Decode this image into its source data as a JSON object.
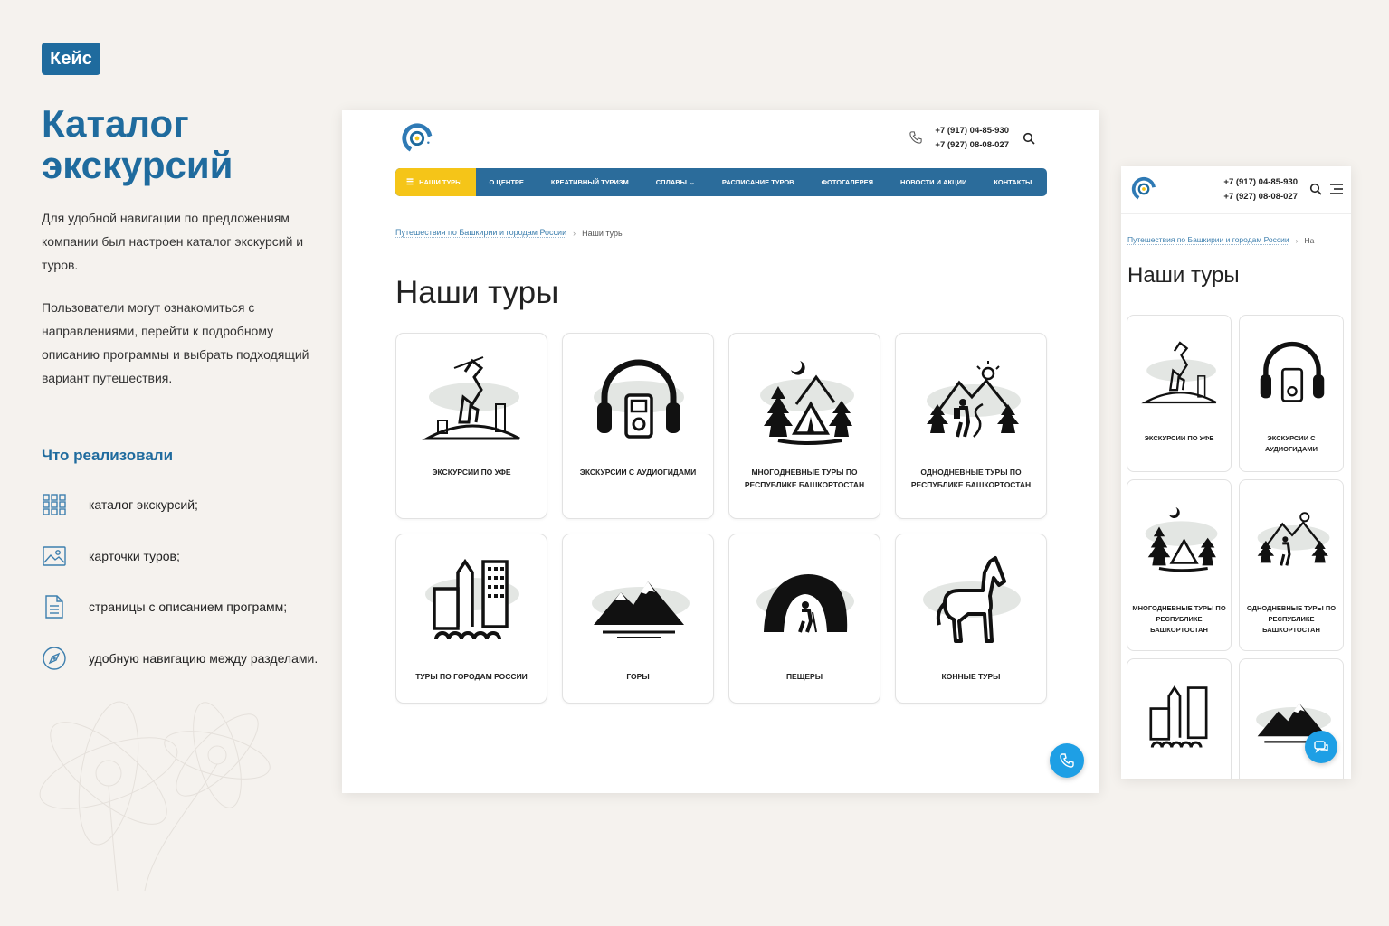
{
  "case": {
    "badge": "Кейс",
    "title": "Каталог экскурсий",
    "paragraph1": "Для удобной навигации по предложениям компании был настроен каталог экскурсий и туров.",
    "paragraph2": "Пользователи могут ознакомиться с направлениями, перейти к подробному описанию программы и выбрать подходящий вариант путешествия.",
    "done_title": "Что реализовали",
    "features": [
      {
        "icon": "grid-icon",
        "label": "каталог экскурсий;"
      },
      {
        "icon": "image-icon",
        "label": "карточки туров;"
      },
      {
        "icon": "document-icon",
        "label": "страницы с описанием программ;"
      },
      {
        "icon": "compass-icon",
        "label": "удобную навигацию между разделами."
      }
    ]
  },
  "site": {
    "phones": [
      "+7 (917) 04-85-930",
      "+7 (927) 08-08-027"
    ],
    "nav": [
      "НАШИ ТУРЫ",
      "О ЦЕНТРЕ",
      "КРЕАТИВНЫЙ ТУРИЗМ",
      "СПЛАВЫ",
      "РАСПИСАНИЕ ТУРОВ",
      "ФОТОГАЛЕРЕЯ",
      "НОВОСТИ И АКЦИИ",
      "КОНТАКТЫ"
    ],
    "breadcrumb": {
      "parent": "Путешествия по Башкирии и городам России",
      "current": "Наши туры",
      "current_short": "На"
    },
    "page_title": "Наши туры",
    "tours": [
      {
        "icon": "monument-icon",
        "label": "ЭКСКУРСИИ ПО УФЕ"
      },
      {
        "icon": "headphones-icon",
        "label": "ЭКСКУРСИИ С АУДИОГИДАМИ"
      },
      {
        "icon": "camping-tent-icon",
        "label": "МНОГОДНЕВНЫЕ ТУРЫ ПО РЕСПУБЛИКЕ БАШКОРТОСТАН"
      },
      {
        "icon": "hiker-icon",
        "label": "ОДНОДНЕВНЫЕ ТУРЫ ПО РЕСПУБЛИКЕ БАШКОРТОСТАН"
      },
      {
        "icon": "city-icon",
        "label": "ТУРЫ ПО ГОРОДАМ РОССИИ"
      },
      {
        "icon": "mountains-icon",
        "label": "ГОРЫ"
      },
      {
        "icon": "cave-icon",
        "label": "ПЕЩЕРЫ"
      },
      {
        "icon": "horse-icon",
        "label": "КОННЫЕ ТУРЫ"
      }
    ]
  },
  "colors": {
    "brand": "#1f6b9e",
    "nav": "#2b6c9b",
    "nav_active": "#f5c518",
    "fab": "#1e9fe5",
    "background": "#f5f2ee"
  }
}
